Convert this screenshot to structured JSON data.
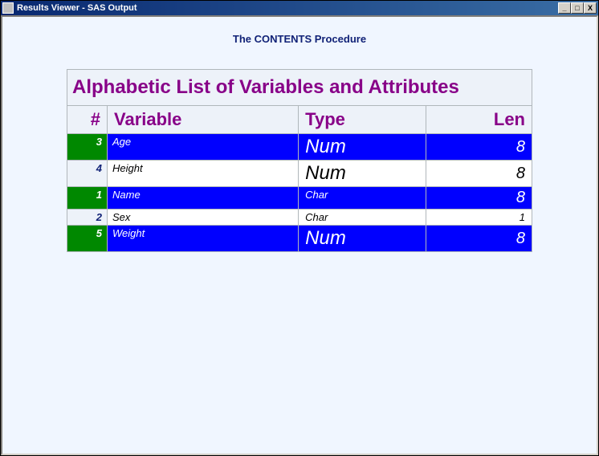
{
  "window": {
    "title": "Results Viewer - SAS Output",
    "controls": {
      "min": "_",
      "max": "□",
      "close": "X"
    }
  },
  "procedure_title": "The CONTENTS Procedure",
  "table": {
    "caption": "Alphabetic List of Variables and Attributes",
    "headers": {
      "num": "#",
      "variable": "Variable",
      "type": "Type",
      "len": "Len"
    },
    "rows": [
      {
        "num": "3",
        "variable": "Age",
        "type": "Num",
        "len": "8",
        "type_big": true,
        "len_small": false
      },
      {
        "num": "4",
        "variable": "Height",
        "type": "Num",
        "len": "8",
        "type_big": true,
        "len_small": false
      },
      {
        "num": "1",
        "variable": "Name",
        "type": "Char",
        "len": "8",
        "type_big": false,
        "len_small": false
      },
      {
        "num": "2",
        "variable": "Sex",
        "type": "Char",
        "len": "1",
        "type_big": false,
        "len_small": true
      },
      {
        "num": "5",
        "variable": "Weight",
        "type": "Num",
        "len": "8",
        "type_big": true,
        "len_small": false
      }
    ]
  }
}
